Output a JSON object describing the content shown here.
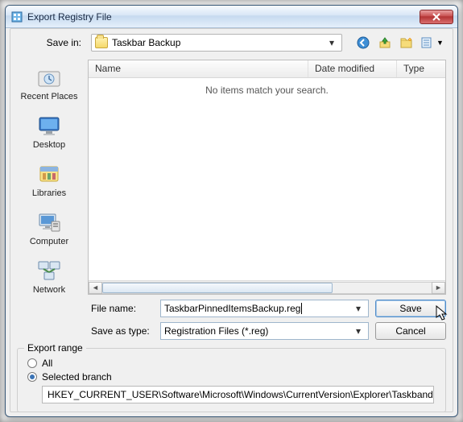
{
  "window": {
    "title": "Export Registry File"
  },
  "toolbar": {
    "save_in_label": "Save in:",
    "save_in_value": "Taskbar Backup",
    "icons": {
      "back": "back-icon",
      "up": "up-one-level-icon",
      "newfolder": "new-folder-icon",
      "views": "views-icon"
    }
  },
  "places": [
    {
      "id": "recent",
      "label": "Recent Places"
    },
    {
      "id": "desktop",
      "label": "Desktop"
    },
    {
      "id": "libraries",
      "label": "Libraries"
    },
    {
      "id": "computer",
      "label": "Computer"
    },
    {
      "id": "network",
      "label": "Network"
    }
  ],
  "listing": {
    "columns": {
      "name": "Name",
      "date": "Date modified",
      "type": "Type"
    },
    "empty_message": "No items match your search."
  },
  "file": {
    "name_label": "File name:",
    "name_value": "TaskbarPinnedItemsBackup.reg",
    "type_label": "Save as type:",
    "type_value": "Registration Files (*.reg)",
    "save_button": "Save",
    "cancel_button": "Cancel"
  },
  "export_range": {
    "legend": "Export range",
    "all_label": "All",
    "selected_label": "Selected branch",
    "selected": "selected_branch",
    "branch_path": "HKEY_CURRENT_USER\\Software\\Microsoft\\Windows\\CurrentVersion\\Explorer\\Taskband"
  }
}
